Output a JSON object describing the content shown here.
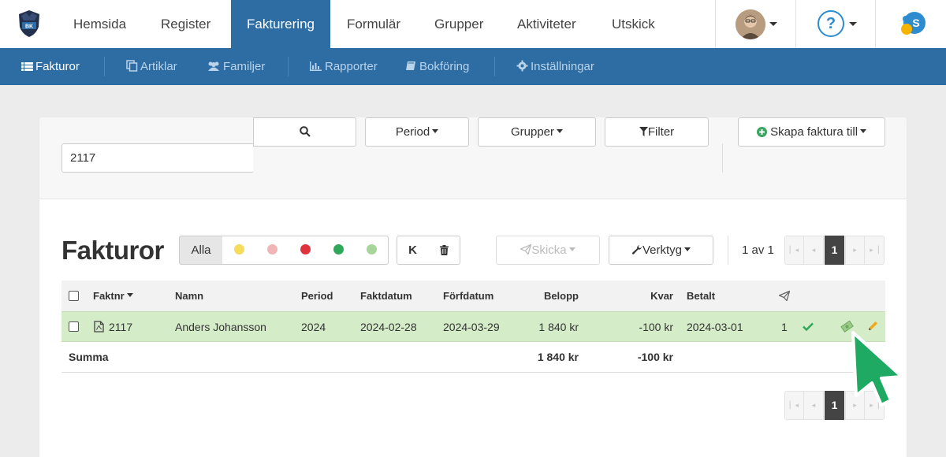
{
  "topnav": {
    "items": [
      {
        "label": "Hemsida"
      },
      {
        "label": "Register"
      },
      {
        "label": "Fakturering"
      },
      {
        "label": "Formulär"
      },
      {
        "label": "Grupper"
      },
      {
        "label": "Aktiviteter"
      },
      {
        "label": "Utskick"
      }
    ],
    "active": "Fakturering",
    "help_label": "?",
    "logo_text": "BK"
  },
  "subnav": {
    "items": [
      {
        "label": "Fakturor",
        "icon": "list-icon"
      },
      {
        "label": "Artiklar",
        "icon": "copy-icon"
      },
      {
        "label": "Familjer",
        "icon": "users-icon"
      },
      {
        "label": "Rapporter",
        "icon": "bar-chart-icon"
      },
      {
        "label": "Bokföring",
        "icon": "book-icon"
      },
      {
        "label": "Inställningar",
        "icon": "gear-icon"
      }
    ],
    "active": "Fakturor"
  },
  "toolbar": {
    "search_value": "2117",
    "period_label": "Period",
    "groups_label": "Grupper",
    "filter_label": "Filter",
    "create_label": "Skapa faktura till"
  },
  "list": {
    "title": "Fakturor",
    "status_all_label": "Alla",
    "status_colors": [
      "#f5dc5a",
      "#f0b5b5",
      "#e0323d",
      "#2fa85a",
      "#a8d59c"
    ],
    "k_label": "K",
    "send_label": "Skicka",
    "tools_label": "Verktyg",
    "page_info": "1 av 1",
    "current_page": "1"
  },
  "table": {
    "headers": {
      "faktnr": "Faktnr",
      "namn": "Namn",
      "period": "Period",
      "faktdatum": "Faktdatum",
      "forfdatum": "Förfdatum",
      "belopp": "Belopp",
      "kvar": "Kvar",
      "betalt": "Betalt"
    },
    "rows": [
      {
        "faktnr": "2117",
        "namn": "Anders Johansson",
        "period": "2024",
        "faktdatum": "2024-02-28",
        "forfdatum": "2024-03-29",
        "belopp": "1 840 kr",
        "kvar": "-100 kr",
        "betalt": "2024-03-01",
        "sent_count": "1"
      }
    ],
    "sum": {
      "label": "Summa",
      "belopp": "1 840 kr",
      "kvar": "-100 kr"
    }
  },
  "colors": {
    "primary": "#2d6da4",
    "row_paid": "#d4ecc8",
    "cursor": "#1faa64"
  }
}
